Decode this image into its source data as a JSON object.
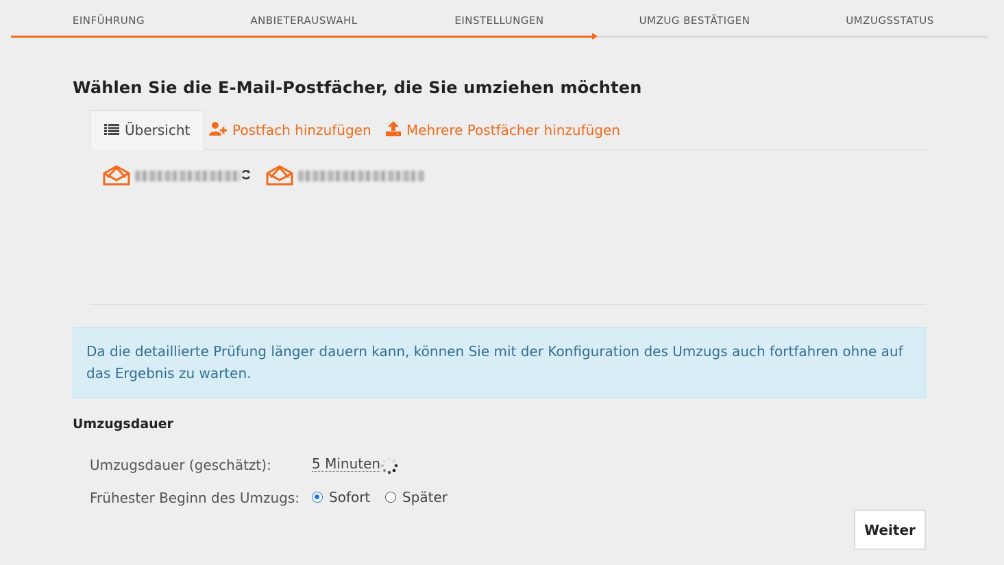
{
  "wizard": {
    "steps": [
      "EINFÜHRUNG",
      "ANBIETERAUSWAHL",
      "EINSTELLUNGEN",
      "UMZUG BESTÄTIGEN",
      "UMZUGSSTATUS"
    ],
    "active_step": 3,
    "accent_color": "#f26a1b"
  },
  "page": {
    "title": "Wählen Sie die E-Mail-Postfächer, die Sie umziehen möchten"
  },
  "tabs": {
    "overview": "Übersicht",
    "add_mailbox": "Postfach hinzufügen",
    "add_multiple": "Mehrere Postfächer hinzufügen"
  },
  "mailboxes": [
    {
      "icon": "mail-open-icon",
      "status_icon": "refresh-icon"
    },
    {
      "icon": "mail-open-icon",
      "status_icon": "pending-icon"
    }
  ],
  "info": {
    "text": "Da die detaillierte Prüfung länger dauern kann, können Sie mit der Konfiguration des Umzugs auch fortfahren ohne auf das Ergebnis zu warten."
  },
  "duration": {
    "heading": "Umzugsdauer",
    "estimated_label": "Umzugsdauer (geschätzt):",
    "estimated_value": "5 Minuten",
    "start_label": "Frühester Beginn des Umzugs:",
    "options": [
      "Sofort",
      "Später"
    ],
    "selected": "Sofort"
  },
  "actions": {
    "next": "Weiter"
  }
}
